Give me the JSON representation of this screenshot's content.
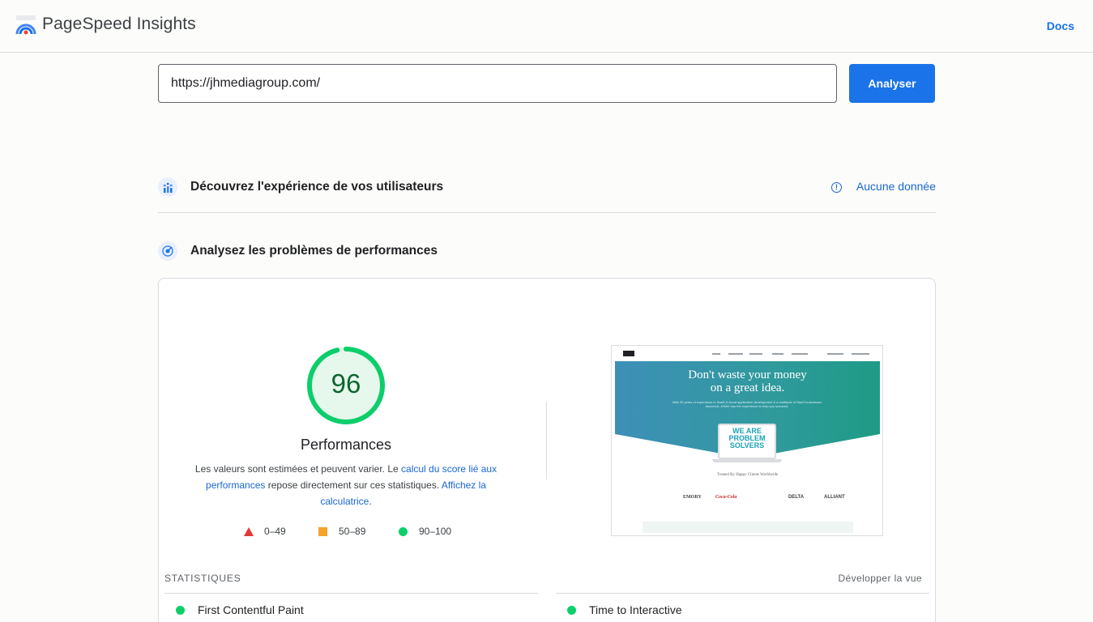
{
  "header": {
    "app_title": "PageSpeed Insights",
    "docs_label": "Docs"
  },
  "search": {
    "url_value": "https://jhmediagroup.com/",
    "analyze_label": "Analyser"
  },
  "sections": {
    "experience_title": "Découvrez l'expérience de vos utilisateurs",
    "no_data_label": "Aucune donnée",
    "performance_title": "Analysez les problèmes de performances"
  },
  "performance": {
    "score": "96",
    "score_fraction": 0.96,
    "label": "Performances",
    "desc_part1": "Les valeurs sont estimées et peuvent varier. Le ",
    "desc_link1": "calcul du score lié aux performances",
    "desc_part2": " repose directement sur ces statistiques. ",
    "desc_link2": "Affichez la calculatrice",
    "desc_part3": ".",
    "legend": [
      {
        "range": "0–49",
        "color": "#e53935",
        "shape": "triangle"
      },
      {
        "range": "50–89",
        "color": "#f4a32c",
        "shape": "square"
      },
      {
        "range": "90–100",
        "color": "#0cce6b",
        "shape": "circle"
      }
    ]
  },
  "screenshot": {
    "headline_line1": "Don't waste your money",
    "headline_line2": "on a great idea.",
    "subtext": "With 20 years of experience in SaaS & cloud application development & a multitude of SaaS businesses launched, JHMG has the experience to help you succeed.",
    "badge_line1": "WE ARE",
    "badge_line2": "PROBLEM",
    "badge_line3": "SOLVERS",
    "trusted_text": "Trusted By Happy Clients Worldwide",
    "clients": [
      "EMORY",
      "Coca-Cola",
      "DELTA",
      "ALLIANT"
    ]
  },
  "stats": {
    "section_label": "STATISTIQUES",
    "expand_label": "Développer la vue",
    "metrics": [
      {
        "name": "First Contentful Paint",
        "status_color": "#0cce6b"
      },
      {
        "name": "Time to Interactive",
        "status_color": "#0cce6b"
      }
    ]
  }
}
